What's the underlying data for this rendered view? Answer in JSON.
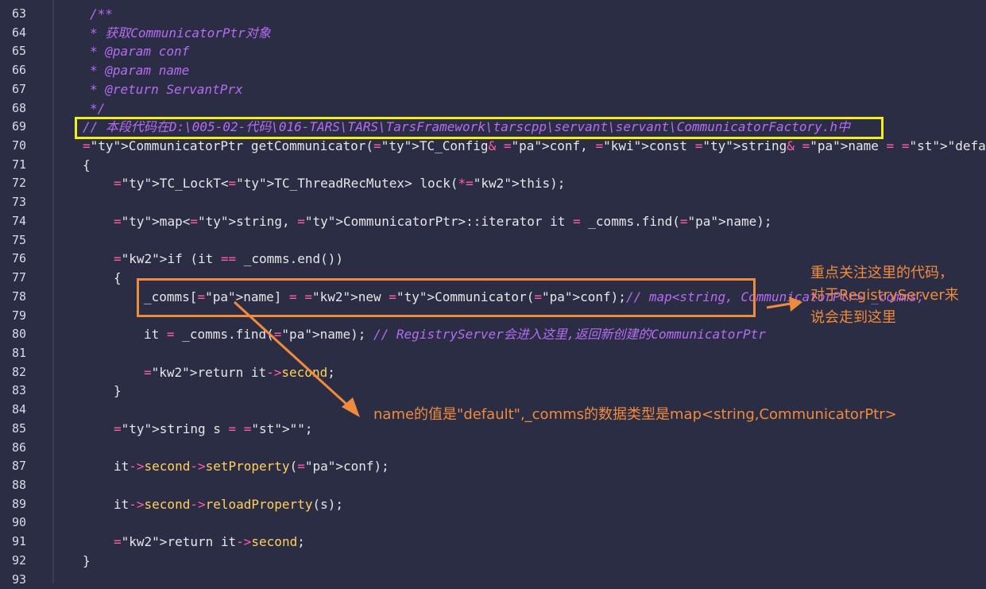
{
  "lines": [
    {
      "num": "63",
      "text": "/**"
    },
    {
      "num": "64",
      "text": "* 获取CommunicatorPtr对象"
    },
    {
      "num": "65",
      "text": "* @param conf"
    },
    {
      "num": "66",
      "text": "* @param name"
    },
    {
      "num": "67",
      "text": "* @return ServantPrx"
    },
    {
      "num": "68",
      "text": "*/"
    },
    {
      "num": "69",
      "text": "// 本段代码在D:\\005-02-代码\\016-TARS\\TARS\\TarsFramework\\tarscpp\\servant\\servant\\CommunicatorFactory.h中"
    },
    {
      "num": "70",
      "text": "CommunicatorPtr getCommunicator(TC_Config& conf, const string& name = \"default\")"
    },
    {
      "num": "71",
      "text": "{"
    },
    {
      "num": "72",
      "text": "TC_LockT<TC_ThreadRecMutex> lock(*this);"
    },
    {
      "num": "73",
      "text": ""
    },
    {
      "num": "74",
      "text": "map<string, CommunicatorPtr>::iterator it = _comms.find(name);"
    },
    {
      "num": "75",
      "text": ""
    },
    {
      "num": "76",
      "text": "if (it == _comms.end())"
    },
    {
      "num": "77",
      "text": "{"
    },
    {
      "num": "78",
      "text": "_comms[name] = new Communicator(conf);// map<string, CommunicatorPtr> _comms;"
    },
    {
      "num": "79",
      "text": ""
    },
    {
      "num": "80",
      "text": "it = _comms.find(name); // RegistryServer会进入这里,返回新创建的CommunicatorPtr"
    },
    {
      "num": "81",
      "text": ""
    },
    {
      "num": "82",
      "text": "return it->second;"
    },
    {
      "num": "83",
      "text": "}"
    },
    {
      "num": "84",
      "text": ""
    },
    {
      "num": "85",
      "text": "string s = \"\";"
    },
    {
      "num": "86",
      "text": ""
    },
    {
      "num": "87",
      "text": "it->second->setProperty(conf);"
    },
    {
      "num": "88",
      "text": ""
    },
    {
      "num": "89",
      "text": "it->second->reloadProperty(s);"
    },
    {
      "num": "90",
      "text": ""
    },
    {
      "num": "91",
      "text": "return it->second;"
    },
    {
      "num": "92",
      "text": "}"
    },
    {
      "num": "93",
      "text": ""
    }
  ],
  "annotations": {
    "right_note": "重点关注这里的代码，\n对于RegistryServer来\n说会走到这里",
    "bottom_note": "name的值是\"default\",_comms的数据类型是map<string,CommunicatorPtr>"
  },
  "colors": {
    "background": "#2b2d45",
    "highlight_box_yellow": "#f2ee16",
    "highlight_box_orange": "#f08a3c",
    "comment": "#b56cf1",
    "type": "#ffcf4d"
  }
}
